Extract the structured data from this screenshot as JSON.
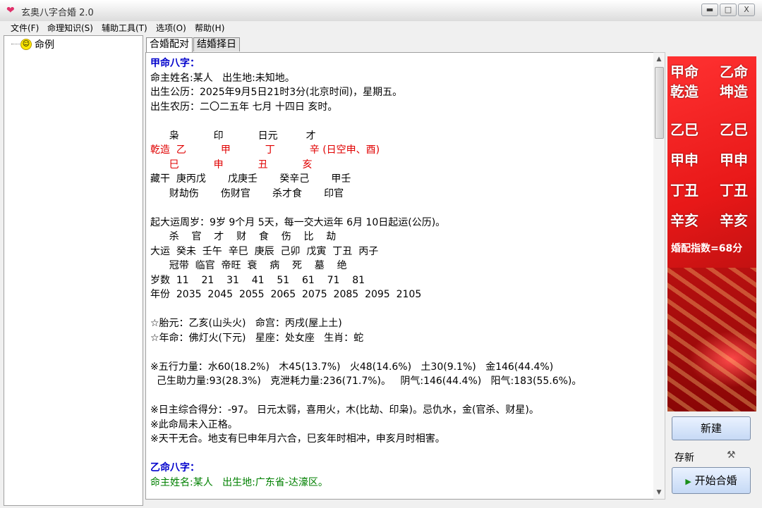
{
  "window": {
    "title": "玄奥八字合婚 2.0",
    "minimize": "▬",
    "maximize": "□",
    "close": "X"
  },
  "menu": [
    "文件(F)",
    "命理知识(S)",
    "辅助工具(T)",
    "选项(O)",
    "帮助(H)"
  ],
  "tree": {
    "root": "命例"
  },
  "tabs": [
    "合婚配对",
    "结婚择日"
  ],
  "content_lines": [
    {
      "text": "甲命八字：",
      "style": "blue"
    },
    {
      "text": "命主姓名:某人   出生地:未知地。",
      "style": ""
    },
    {
      "text": "出生公历：2025年9月5日21时3分(北京时间)，星期五。",
      "style": ""
    },
    {
      "text": "出生农历：二〇二五年 七月 十四日 亥时。",
      "style": ""
    },
    {
      "text": "",
      "style": ""
    },
    {
      "text": "      枭           印           日元         才",
      "style": ""
    },
    {
      "text": "乾造  乙           甲           丁           辛 (日空申、酉)",
      "style": "red"
    },
    {
      "text": "      巳           申           丑           亥",
      "style": "red"
    },
    {
      "text": "藏干  庚丙戊       戊庚壬       癸辛己       甲壬",
      "style": ""
    },
    {
      "text": "      财劫伤       伤财官       杀才食       印官",
      "style": ""
    },
    {
      "text": "",
      "style": ""
    },
    {
      "text": "起大运周岁：9岁 9个月 5天，每一交大运年 6月 10日起运(公历)。",
      "style": ""
    },
    {
      "text": "      杀    官    才    财    食    伤    比    劫",
      "style": ""
    },
    {
      "text": "大运  癸未  壬午  辛巳  庚辰  己卯  戊寅  丁丑  丙子",
      "style": ""
    },
    {
      "text": "      冠带  临官  帝旺  衰    病    死    墓    绝",
      "style": ""
    },
    {
      "text": "岁数  11    21    31    41    51    61    71    81",
      "style": ""
    },
    {
      "text": "年份  2035  2045  2055  2065  2075  2085  2095  2105",
      "style": ""
    },
    {
      "text": "",
      "style": ""
    },
    {
      "text": "☆胎元：乙亥(山头火)   命宫：丙戌(屋上土)",
      "style": ""
    },
    {
      "text": "☆年命：佛灯火(下元)   星座：处女座   生肖：蛇",
      "style": ""
    },
    {
      "text": "",
      "style": ""
    },
    {
      "text": "※五行力量：水60(18.2%)   木45(13.7%)   火48(14.6%)   土30(9.1%)   金146(44.4%)",
      "style": ""
    },
    {
      "text": "  己生助力量:93(28.3%)   克泄耗力量:236(71.7%)。   阴气:146(44.4%)   阳气:183(55.6%)。",
      "style": ""
    },
    {
      "text": "",
      "style": ""
    },
    {
      "text": "※日主综合得分：-97。 日元太弱，喜用火，木(比劫、印枭)。忌仇水，金(官杀、财星)。",
      "style": ""
    },
    {
      "text": "※此命局未入正格。",
      "style": ""
    },
    {
      "text": "※天干无合。地支有巳申年月六合，巳亥年时相冲，申亥月时相害。",
      "style": ""
    },
    {
      "text": "",
      "style": ""
    },
    {
      "text": "乙命八字：",
      "style": "blue"
    },
    {
      "text": "命主姓名:某人   出生地:广东省-达濠区。",
      "style": "green"
    }
  ],
  "banner": {
    "header_a": [
      "甲命",
      "乾造"
    ],
    "header_b": [
      "乙命",
      "坤造"
    ],
    "pillars_a": [
      "乙巳",
      "甲申",
      "丁丑",
      "辛亥"
    ],
    "pillars_b": [
      "乙巳",
      "甲申",
      "丁丑",
      "辛亥"
    ],
    "index_text": "婚配指数=68分"
  },
  "buttons": {
    "new": "新建",
    "save": "存新",
    "start": "开始合婚"
  }
}
